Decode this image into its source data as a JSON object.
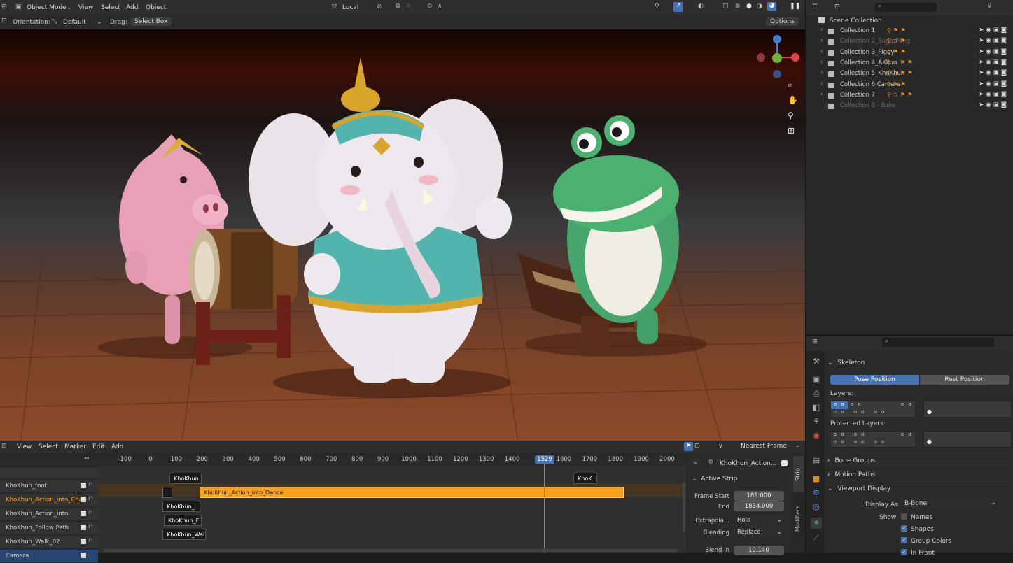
{
  "viewport_header": {
    "mode": "Object Mode",
    "menus": [
      "View",
      "Select",
      "Add",
      "Object"
    ],
    "transform_orientation": "Local",
    "orientation_label": "Orientation:",
    "orientation_value": "Default",
    "drag_label": "Drag:",
    "drag_value": "Select Box",
    "options_label": "Options"
  },
  "outliner": {
    "search_placeholder": "",
    "root": "Scene Collection",
    "items": [
      {
        "label": "Collection 1",
        "tags": "⚲ ⚑ ⚑",
        "dim": false
      },
      {
        "label": "Collection 2_SugarPeng",
        "tags": "⚲ ⊃ ⚑",
        "dim": true
      },
      {
        "label": "Collection 3_Piggy",
        "tags": "⚲ ⚑ ⚑",
        "dim": false
      },
      {
        "label": "Collection 4_AKkuu",
        "tags": "⚲ ⊃ ⚑ ⚑",
        "dim": false
      },
      {
        "label": "Collection 5_KhoKhun",
        "tags": "⚲ ⊃ ⚑ ⚑",
        "dim": false
      },
      {
        "label": "Collection 6 Camera",
        "tags": "⚲ ⚑ ⚑",
        "dim": false
      },
      {
        "label": "Collection 7",
        "tags": "⚲ ⊃ ⚑ ⚑",
        "dim": false
      },
      {
        "label": "Collection 8 - Bake",
        "tags": "",
        "dim": true
      }
    ]
  },
  "properties": {
    "skeleton_label": "Skeleton",
    "pose_position": "Pose Position",
    "rest_position": "Rest Position",
    "layers_label": "Layers:",
    "protected_layers_label": "Protected Layers:",
    "bone_groups": "Bone Groups",
    "motion_paths": "Motion Paths",
    "viewport_display": "Viewport Display",
    "display_as_label": "Display As",
    "display_as_value": "B-Bone",
    "show_label": "Show",
    "names": "Names",
    "shapes": "Shapes",
    "group_colors": "Group Colors",
    "in_front": "In Front"
  },
  "nla": {
    "menus": [
      "View",
      "Select",
      "Marker",
      "Edit",
      "Add"
    ],
    "snap": "Nearest Frame",
    "current_frame": "1529",
    "ruler": [
      {
        "label": "-100",
        "frame": -100
      },
      {
        "label": "0",
        "frame": 0
      },
      {
        "label": "100",
        "frame": 100
      },
      {
        "label": "200",
        "frame": 200
      },
      {
        "label": "300",
        "frame": 300
      },
      {
        "label": "400",
        "frame": 400
      },
      {
        "label": "500",
        "frame": 500
      },
      {
        "label": "600",
        "frame": 600
      },
      {
        "label": "700",
        "frame": 700
      },
      {
        "label": "800",
        "frame": 800
      },
      {
        "label": "900",
        "frame": 900
      },
      {
        "label": "1000",
        "frame": 1000
      },
      {
        "label": "1100",
        "frame": 1100
      },
      {
        "label": "1200",
        "frame": 1200
      },
      {
        "label": "1300",
        "frame": 1300
      },
      {
        "label": "1400",
        "frame": 1400
      },
      {
        "label": "1",
        "frame": 1500
      },
      {
        "label": "1600",
        "frame": 1600
      },
      {
        "label": "1700",
        "frame": 1700
      },
      {
        "label": "1800",
        "frame": 1800
      },
      {
        "label": "1900",
        "frame": 1900
      },
      {
        "label": "2000",
        "frame": 2000
      }
    ],
    "tracks": [
      {
        "label": "KhoKhun_foot",
        "active": false
      },
      {
        "label": "KhoKhun_Action_into_Cha",
        "active": true
      },
      {
        "label": "KhoKhun_Action_into",
        "active": false
      },
      {
        "label": "KhoKhun_Follow Path",
        "active": false
      },
      {
        "label": "KhoKhun_Walk_02",
        "active": false
      },
      {
        "label": "Camera",
        "active": false,
        "camera": true
      }
    ],
    "strips": {
      "top_left": "KhoKhun",
      "top_right": "KhoK",
      "main": "KhoKhun_Action_into_Dance",
      "row2": "KhoKhun_",
      "row3": "KhoKhun_F",
      "row4": "KhoKhun_Wal"
    }
  },
  "sidebar": {
    "header_value": "KhoKhun_Action...",
    "active_strip": "Active Strip",
    "frame_start_label": "Frame Start",
    "frame_start": "189.000",
    "end_label": "End",
    "end": "1834.000",
    "extrapolation_label": "Extrapola...",
    "extrapolation": "Hold",
    "blending_label": "Blending",
    "blending": "Replace",
    "blend_in_label": "Blend In",
    "blend_in": "10.140",
    "tab_strip": "Strip",
    "tab_modifiers": "Modifiers"
  },
  "colors": {
    "accent_blue": "#4772b3",
    "strip_orange": "#f5a11a",
    "playhead": "#4c8fd6"
  }
}
